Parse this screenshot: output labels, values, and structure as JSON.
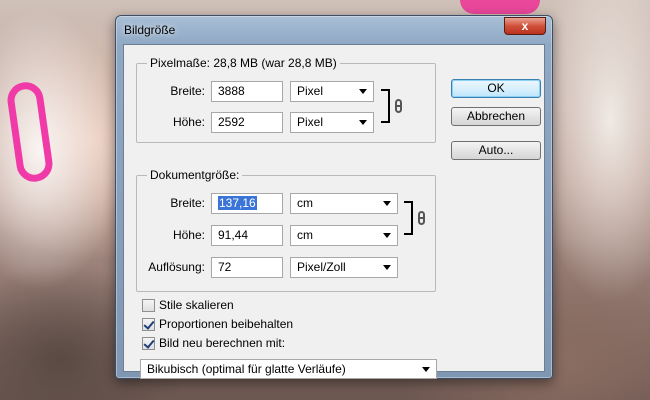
{
  "window": {
    "title": "Bildgröße",
    "close_label": "x"
  },
  "pixel_dimensions": {
    "label": "Pixelmaße: 28,8 MB (war 28,8 MB)",
    "width_label": "Breite:",
    "width_value": "3888",
    "width_unit": "Pixel",
    "height_label": "Höhe:",
    "height_value": "2592",
    "height_unit": "Pixel"
  },
  "document_size": {
    "label": "Dokumentgröße:",
    "width_label": "Breite:",
    "width_value": "137,16",
    "width_unit": "cm",
    "height_label": "Höhe:",
    "height_value": "91,44",
    "height_unit": "cm",
    "resolution_label": "Auflösung:",
    "resolution_value": "72",
    "resolution_unit": "Pixel/Zoll"
  },
  "options": {
    "scale_styles": {
      "label": "Stile skalieren",
      "checked": false
    },
    "constrain_proportions": {
      "label": "Proportionen beibehalten",
      "checked": true
    },
    "resample": {
      "label": "Bild neu berechnen mit:",
      "checked": true
    },
    "resample_method": "Bikubisch (optimal für glatte Verläufe)"
  },
  "buttons": {
    "ok": "OK",
    "cancel": "Abbrechen",
    "auto": "Auto..."
  },
  "icons": {
    "chain": "chain-link-icon",
    "dropdown": "chevron-down-icon"
  }
}
